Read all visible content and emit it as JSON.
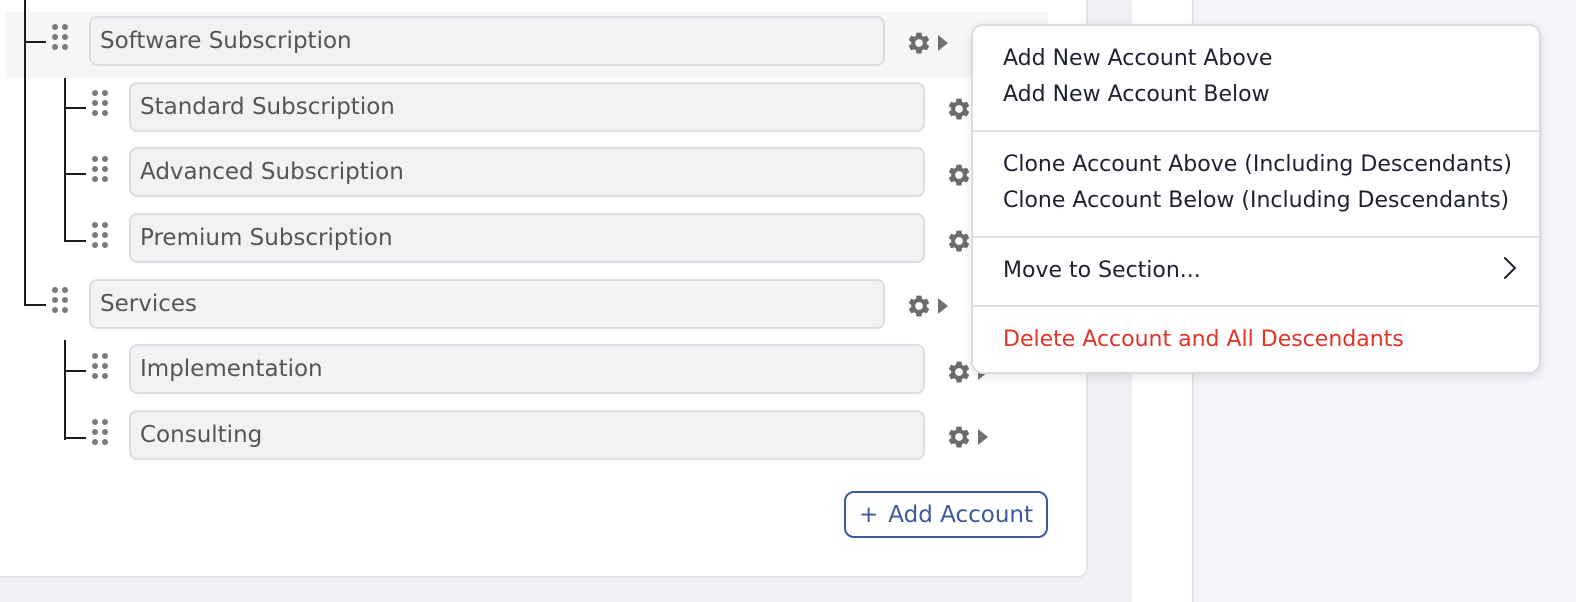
{
  "accounts": [
    {
      "label": "Software Subscription"
    },
    {
      "label": "Standard Subscription"
    },
    {
      "label": "Advanced Subscription"
    },
    {
      "label": "Premium Subscription"
    },
    {
      "label": "Services"
    },
    {
      "label": "Implementation"
    },
    {
      "label": "Consulting"
    }
  ],
  "add_account": {
    "plus": "+",
    "label": "Add Account"
  },
  "context_menu": {
    "add_above": "Add New Account Above",
    "add_below": "Add New Account Below",
    "clone_above": "Clone Account Above (Including Descendants)",
    "clone_below": "Clone Account Below (Including Descendants)",
    "move_to_section": "Move to Section...",
    "delete": "Delete Account and All Descendants"
  },
  "colors": {
    "accent": "#3b5a9a",
    "danger": "#e0342a"
  },
  "icons": {
    "drag": "drag-handle-icon",
    "gear": "gear-icon",
    "caret": "caret-right-icon",
    "chevron": "chevron-right-icon"
  }
}
